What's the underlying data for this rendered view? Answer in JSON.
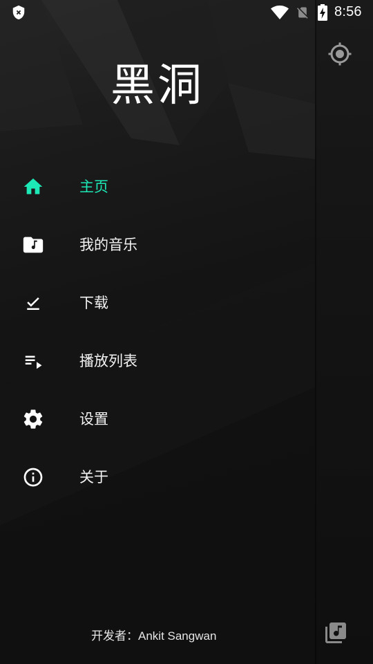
{
  "status_bar": {
    "time": "8:56",
    "icons": [
      "shield-x-icon",
      "wifi-icon",
      "no-sim-icon",
      "battery-charging-icon"
    ]
  },
  "drawer": {
    "title": "黑洞",
    "active_color": "#1de9b6",
    "items": [
      {
        "label": "主页",
        "icon": "home-icon",
        "active": true
      },
      {
        "label": "我的音乐",
        "icon": "music-folder-icon",
        "active": false
      },
      {
        "label": "下载",
        "icon": "download-icon",
        "active": false
      },
      {
        "label": "播放列表",
        "icon": "playlist-icon",
        "active": false
      },
      {
        "label": "设置",
        "icon": "gear-icon",
        "active": false
      },
      {
        "label": "关于",
        "icon": "info-icon",
        "active": false
      }
    ],
    "credit": "开发者：Ankit Sangwan"
  },
  "main": {
    "icons": [
      "location-target-icon",
      "music-library-icon"
    ]
  }
}
